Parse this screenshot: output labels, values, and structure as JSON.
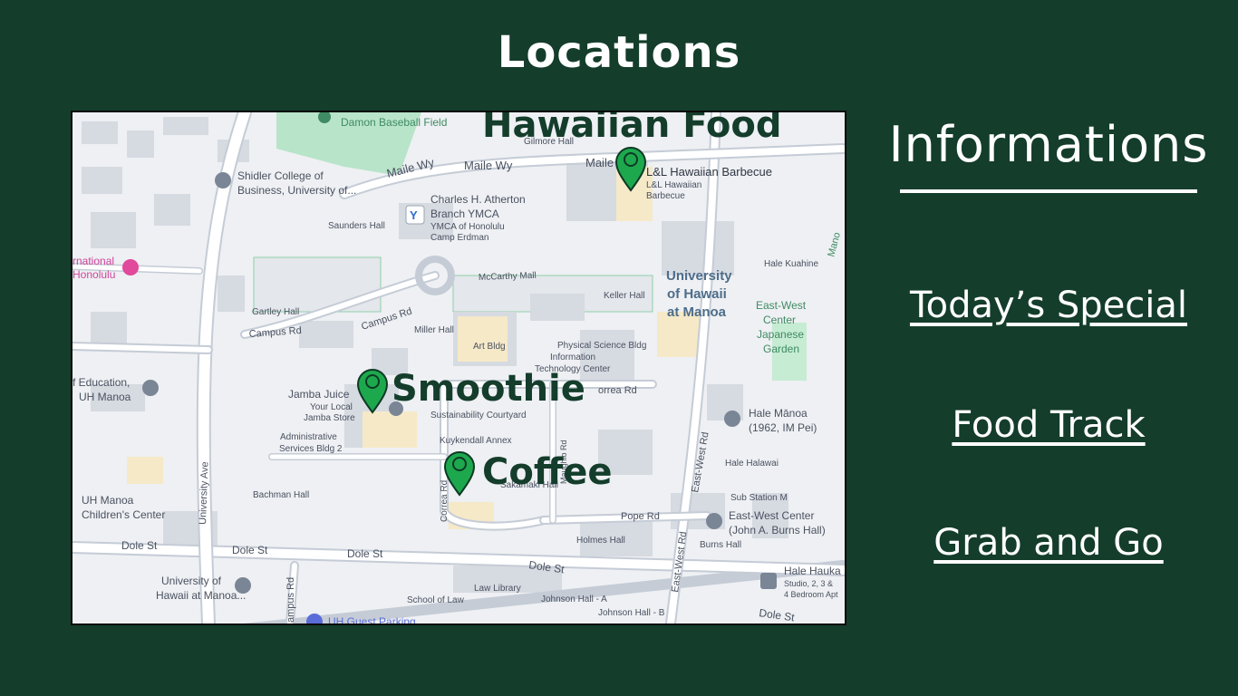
{
  "page": {
    "title": "Locations"
  },
  "info": {
    "title": "Informations",
    "links": [
      {
        "label": "Today’s Special"
      },
      {
        "label": "Food Track"
      },
      {
        "label": "Grab and Go"
      }
    ]
  },
  "map": {
    "pins": [
      {
        "label": "Hawaiian Food"
      },
      {
        "label": "Smoothie"
      },
      {
        "label": "Coffee"
      }
    ],
    "places": {
      "damon_baseball": "Damon Baseball Field",
      "gilmore": "Gilmore Hall",
      "maile_wy_1": "Maile Wy",
      "maile_wy_2": "Maile Wy",
      "maile_wy_3": "Maile",
      "lnl": "L&L Hawaiian Barbecue",
      "lnl_sub": "L&L Hawaiian",
      "lnl_sub2": "Barbecue",
      "shidler_1": "Shidler College of",
      "shidler_2": "Business, University of...",
      "ymca_1": "Charles H. Atherton",
      "ymca_2": "Branch YMCA",
      "ymca_3": "YMCA of Honolulu",
      "ymca_4": "Camp Erdman",
      "saunders": "Saunders Hall",
      "intl_1": "rnational",
      "intl_2": "Honolulu",
      "mccarthy": "McCarthy Mall",
      "hale_kuahine": "Hale Kuahine",
      "uh_1": "University",
      "uh_2": "of Hawaii",
      "uh_3": "at Manoa",
      "keller": "Keller Hall",
      "gartley": "Gartley Hall",
      "campus_rd_1": "Campus Rd",
      "campus_rd_2": "Campus Rd",
      "miller": "Miller Hall",
      "art": "Art Bldg",
      "physci": "Physical Science Bldg",
      "itc_1": "Information",
      "itc_2": "Technology Center",
      "ew_1": "East-West",
      "ew_2": "Center",
      "ew_3": "Japanese",
      "ew_4": "Garden",
      "edu_1": "f Education,",
      "edu_2": "UH Manoa",
      "jamba": "Jamba Juice",
      "jamba_sub1": "Your Local",
      "jamba_sub2": "Jamba Store",
      "correa_1": "orrea Rd",
      "sustain": "Sustainability Courtyard",
      "hale_manoa_1": "Hale Mānoa",
      "hale_manoa_2": "(1962, IM Pei)",
      "admin_1": "Administrative",
      "admin_2": "Services Bldg 2",
      "kuykendall": "Kuykendall Annex",
      "hale_halawai": "Hale Halawai",
      "eastwest_rd_1": "East-West Rd",
      "eastwest_rd_2": "East-West Rd",
      "university_ave": "University Ave",
      "bachman": "Bachman Hall",
      "sakamaki": "Sakamaki Hall",
      "substation": "Sub Station M",
      "uh_children_1": "UH Manoa",
      "uh_children_2": "Children's Center",
      "pope": "Pope Rd",
      "ewc_burns_1": "East-West Center",
      "ewc_burns_2": "(John A. Burns Hall)",
      "dole_1": "Dole St",
      "dole_2": "Dole St",
      "dole_3": "Dole St",
      "dole_4": "Dole St",
      "dole_5": "Dole St",
      "holmes": "Holmes Hall",
      "burns_hall": "Burns Hall",
      "hale_hauka_1": "Hale Hauka",
      "hale_hauka_2": "Studio, 2, 3 &",
      "hale_hauka_3": "4 Bedroom Apt",
      "uh_manoa_bldg_1": "University of",
      "uh_manoa_bldg_2": "Hawaii at Manoa...",
      "law_library": "Law Library",
      "school_of_law": "School of Law",
      "johnson_a": "Johnson Hall - A",
      "johnson_b": "Johnson Hall - B",
      "guest_parking": "UH Guest Parking",
      "correa_rd_v": "Correa Rd",
      "campus_rd_v": "ampus Rd",
      "maile_v": "Mano",
      "naughio": "Maughio Rd"
    },
    "colors": {
      "land": "#eef0f3",
      "road": "#ffffff",
      "road_edge": "#c5ccd6",
      "building": "#d9dde3",
      "park": "#b8e4c9",
      "pin": "#1ea84e",
      "pin_outline": "#0d3a25"
    }
  }
}
